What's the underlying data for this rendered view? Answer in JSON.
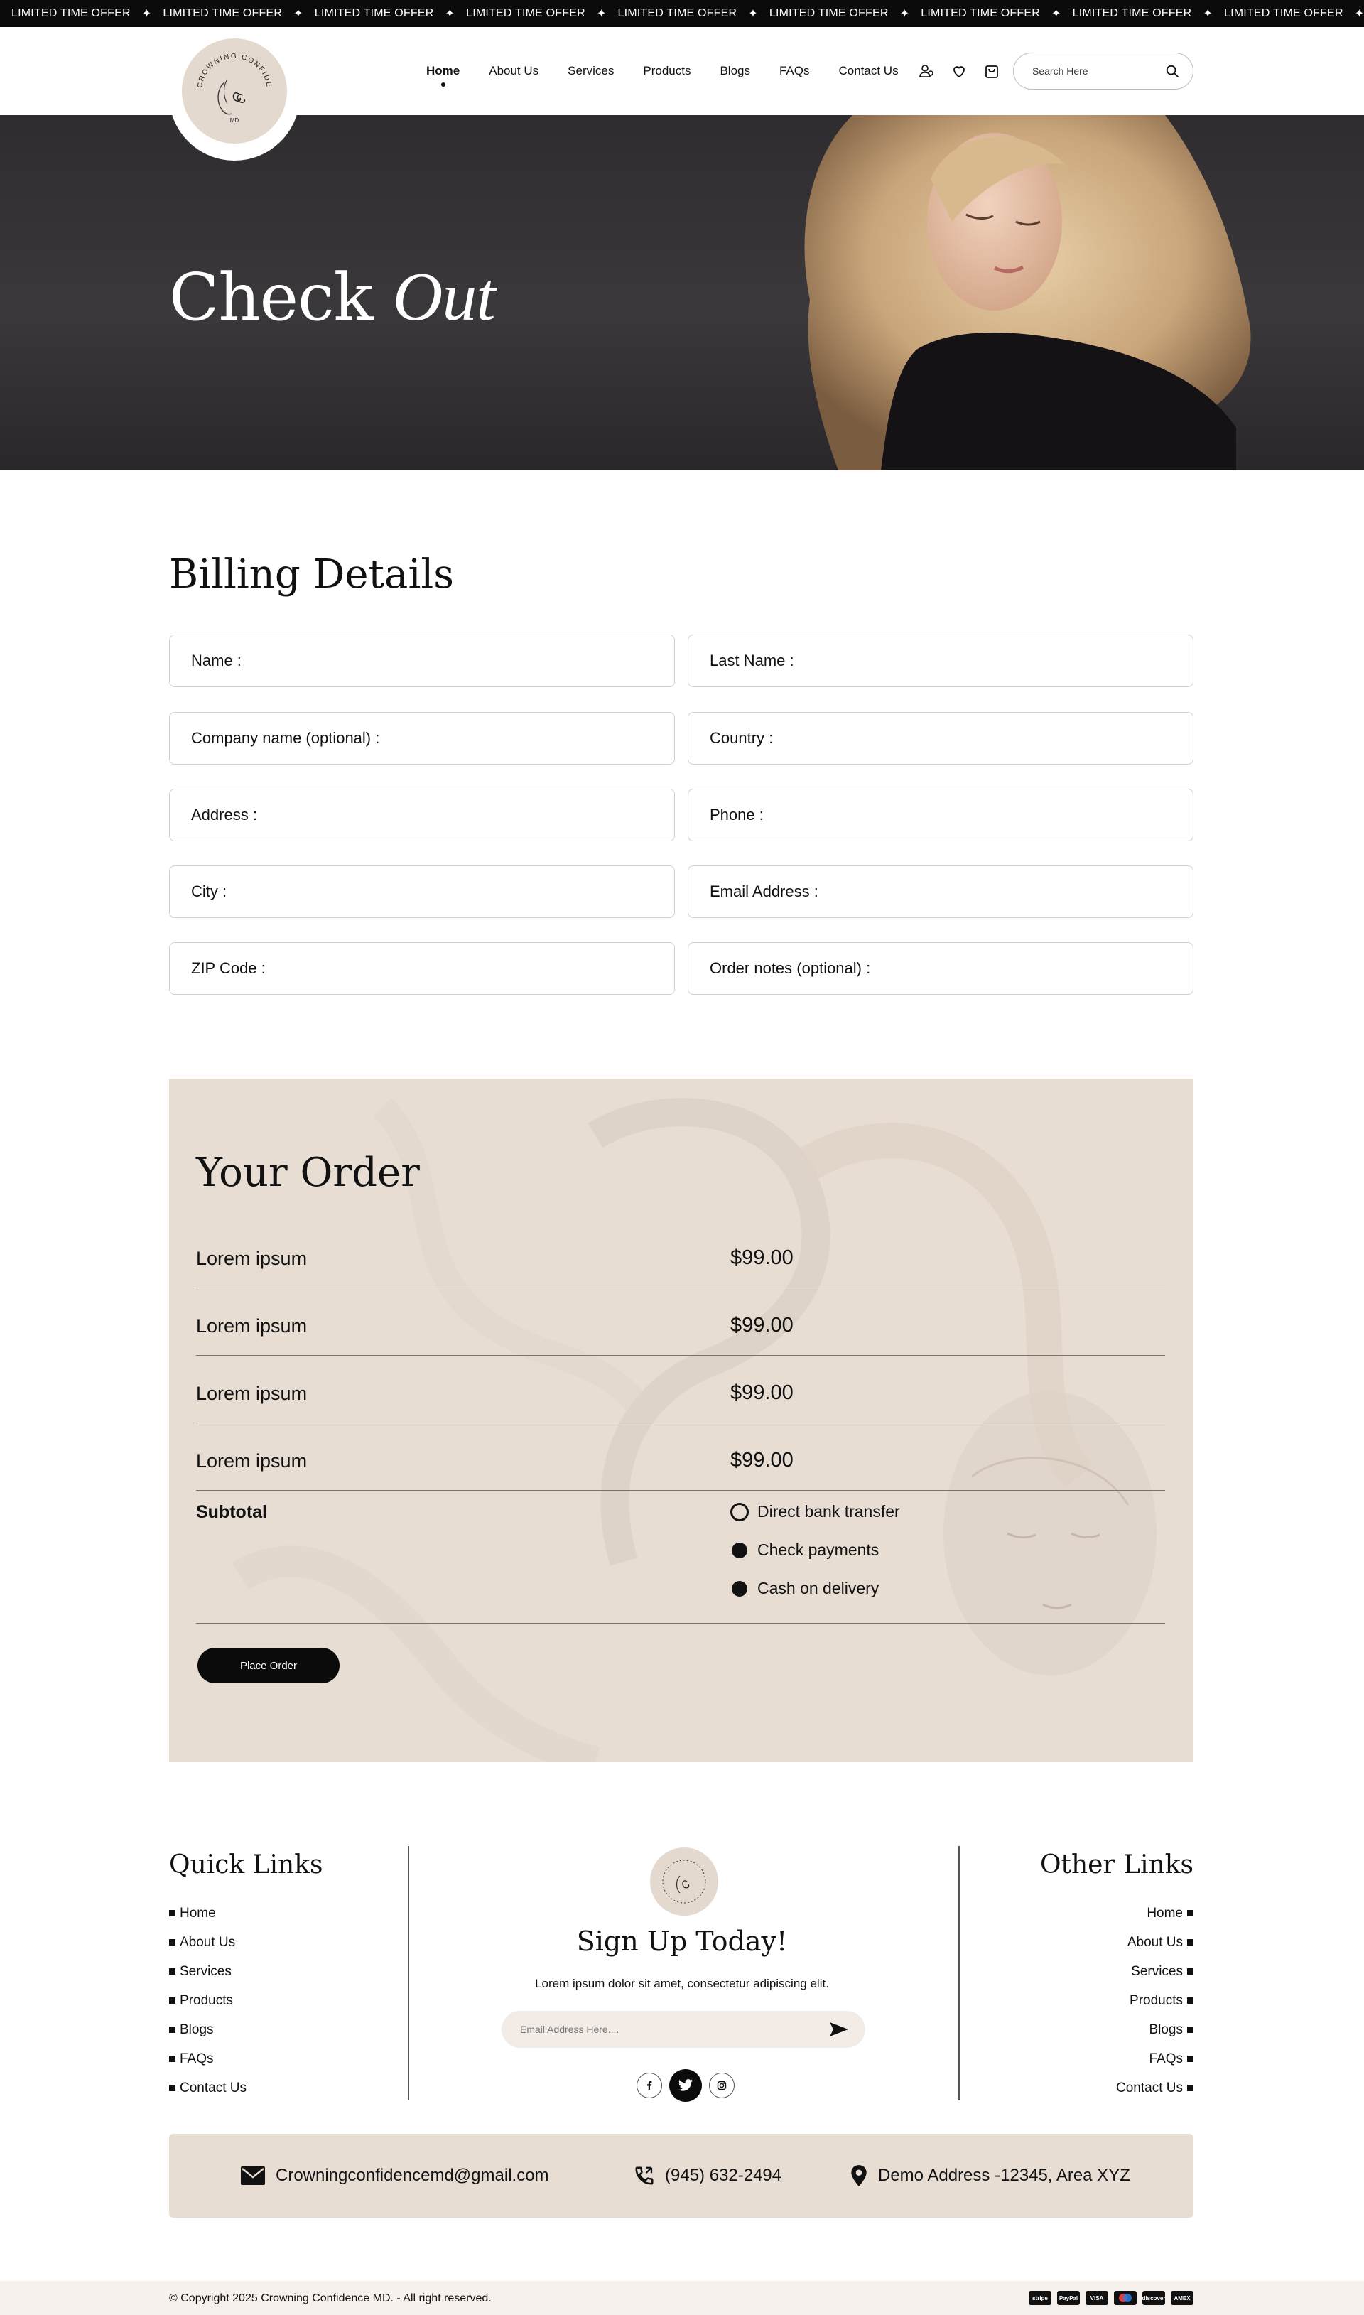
{
  "ticker": {
    "text": "LIMITED TIME OFFER",
    "separator": "✦"
  },
  "brand": {
    "logo_text": "CROWNING CONFIDENCE",
    "logo_sub": "MD"
  },
  "nav": {
    "items": [
      "Home",
      "About Us",
      "Services",
      "Products",
      "Blogs",
      "FAQs",
      "Contact Us"
    ],
    "active": "Home"
  },
  "search": {
    "placeholder": "Search Here"
  },
  "hero": {
    "title_main": "Check",
    "title_script": "Out"
  },
  "billing": {
    "title": "Billing Details",
    "fields": [
      "Name :",
      "Last Name :",
      "Company name (optional) :",
      "Country :",
      "Address :",
      "Phone :",
      "City :",
      "Email Address :",
      "ZIP Code :",
      "Order notes (optional) :"
    ]
  },
  "order": {
    "title": "Your Order",
    "items": [
      {
        "name": "Lorem ipsum",
        "price": "$99.00"
      },
      {
        "name": "Lorem ipsum",
        "price": "$99.00"
      },
      {
        "name": "Lorem ipsum",
        "price": "$99.00"
      },
      {
        "name": "Lorem ipsum",
        "price": "$99.00"
      }
    ],
    "subtotal_label": "Subtotal",
    "payment_options": [
      {
        "label": "Direct bank transfer",
        "selected": false
      },
      {
        "label": "Check payments",
        "selected": true
      },
      {
        "label": "Cash on delivery",
        "selected": true
      }
    ],
    "place_order": "Place Order"
  },
  "footer": {
    "quick_links_title": "Quick Links",
    "quick_links": [
      "Home",
      "About Us",
      "Services",
      "Products",
      "Blogs",
      "FAQs",
      "Contact Us"
    ],
    "other_links_title": "Other Links",
    "other_links": [
      "Home",
      "About Us",
      "Services",
      "Products",
      "Blogs",
      "FAQs",
      "Contact Us"
    ],
    "signup_title": "Sign Up Today!",
    "signup_text": "Lorem ipsum dolor sit amet, consectetur adipiscing elit.",
    "email_placeholder": "Email Address Here....",
    "socials": [
      "facebook-icon",
      "twitter-icon",
      "instagram-icon"
    ]
  },
  "contact": {
    "email": "Crowningconfidencemd@gmail.com",
    "phone": "(945) 632-2494",
    "address": "Demo Address -12345, Area XYZ"
  },
  "copyright": "© Copyright 2025 Crowning Confidence MD. - All right reserved.",
  "payment_logos": [
    "stripe",
    "PayPal",
    "VISA",
    "mastercard",
    "discover",
    "AMEX"
  ],
  "colors": {
    "accent_beige": "#e7ddd3",
    "dark": "#0b0b0b",
    "hero_bg": "#353236"
  }
}
